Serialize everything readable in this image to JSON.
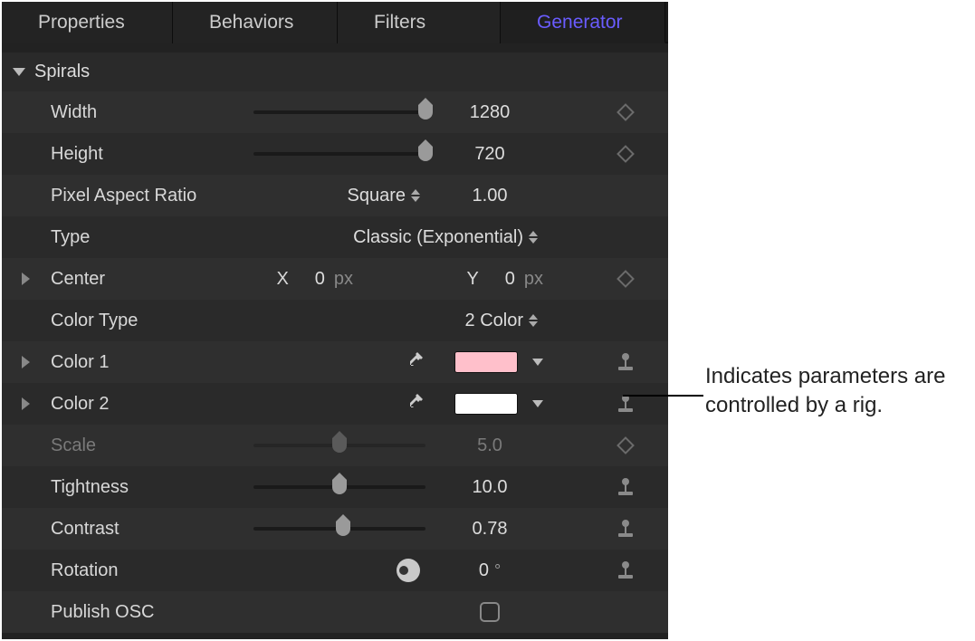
{
  "tabs": [
    "Properties",
    "Behaviors",
    "Filters",
    "Generator"
  ],
  "active_tab": "Generator",
  "section": "Spirals",
  "params": {
    "width": {
      "label": "Width",
      "value": "1280",
      "slider_pct": 100,
      "kf": "diamond"
    },
    "height": {
      "label": "Height",
      "value": "720",
      "slider_pct": 100,
      "kf": "diamond"
    },
    "par": {
      "label": "Pixel Aspect Ratio",
      "popup": "Square",
      "value": "1.00"
    },
    "type": {
      "label": "Type",
      "popup": "Classic (Exponential)"
    },
    "center": {
      "label": "Center",
      "x_label": "X",
      "x_val": "0",
      "x_unit": "px",
      "y_label": "Y",
      "y_val": "0",
      "y_unit": "px",
      "kf": "diamond"
    },
    "colortype": {
      "label": "Color Type",
      "popup": "2 Color"
    },
    "color1": {
      "label": "Color 1",
      "swatch": "#ffc0cb",
      "kf": "joystick"
    },
    "color2": {
      "label": "Color 2",
      "swatch": "#ffffff",
      "kf": "joystick"
    },
    "scale": {
      "label": "Scale",
      "value": "5.0",
      "slider_pct": 50,
      "dim": true,
      "kf": "diamond"
    },
    "tight": {
      "label": "Tightness",
      "value": "10.0",
      "slider_pct": 50,
      "kf": "joystick"
    },
    "contrast": {
      "label": "Contrast",
      "value": "0.78",
      "slider_pct": 52,
      "kf": "joystick"
    },
    "rotation": {
      "label": "Rotation",
      "value": "0",
      "unit": "°",
      "kf": "joystick"
    },
    "publish": {
      "label": "Publish OSC"
    }
  },
  "callout": "Indicates parameters are controlled by a rig."
}
